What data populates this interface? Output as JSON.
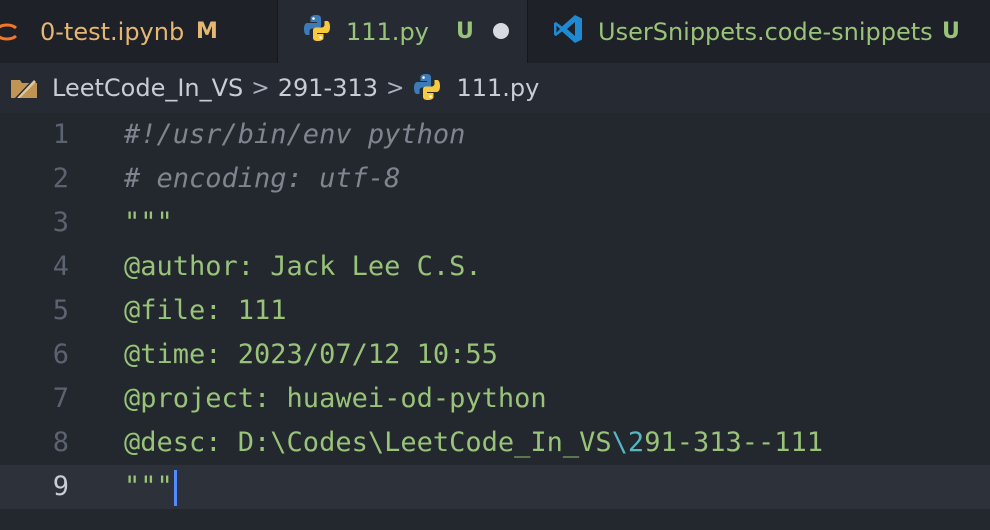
{
  "tabs": [
    {
      "label": "0-test.ipynb",
      "status": "M",
      "icon": "jupyter-icon"
    },
    {
      "label": "111.py",
      "status": "U",
      "icon": "python-icon",
      "dirty": true
    },
    {
      "label": "UserSnippets.code-snippets",
      "status": "U",
      "icon": "vscode-icon"
    }
  ],
  "breadcrumb": {
    "items": [
      "LeetCode_In_VS",
      "291-313",
      "111.py"
    ],
    "separator": ">"
  },
  "editor": {
    "lines": [
      {
        "n": "1",
        "text": "#!/usr/bin/env python"
      },
      {
        "n": "2",
        "text": "# encoding: utf-8"
      },
      {
        "n": "3",
        "text": "\"\"\""
      },
      {
        "n": "4",
        "text": "@author: Jack Lee C.S."
      },
      {
        "n": "5",
        "text": "@file: 111"
      },
      {
        "n": "6",
        "text": "@time: 2023/07/12 10:55"
      },
      {
        "n": "7",
        "text": "@project: huawei-od-python"
      },
      {
        "n": "8",
        "text_a": "@desc: D:\\Codes\\LeetCode_In_VS",
        "text_esc": "\\2",
        "text_b": "91-313--111"
      },
      {
        "n": "9",
        "text": "\"\"\""
      }
    ]
  },
  "colors": {
    "string": "#98c379",
    "comment": "#7f848e",
    "escape": "#56b6c2",
    "modified": "#e6b673",
    "cursor": "#528bff"
  }
}
